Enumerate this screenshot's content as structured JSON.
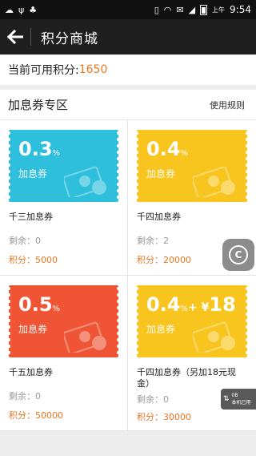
{
  "status_bar": {
    "icons_left": [
      "cloud-icon",
      "usb-icon",
      "cat-icon"
    ],
    "icons_right": [
      "vibrate-icon",
      "wifi-icon",
      "message-icon",
      "signal-icon",
      "battery-icon"
    ],
    "ampm": "上午",
    "time": "9:54"
  },
  "appbar": {
    "title": "积分商城",
    "back_icon": "arrow-left-icon"
  },
  "points": {
    "label": "当前可用积分:",
    "value": "1650"
  },
  "section": {
    "title": "加息券专区",
    "rules_link": "使用规则"
  },
  "cards": [
    {
      "rate": "0.3",
      "pct": "%",
      "plus": "",
      "extra": "",
      "type": "加息券",
      "name": "千三加息券",
      "remain": "剩余：0",
      "points": "积分：5000",
      "color": "#2ebfdc"
    },
    {
      "rate": "0.4",
      "pct": "%",
      "plus": "",
      "extra": "",
      "type": "加息券",
      "name": "千四加息券",
      "remain": "剩余：2",
      "points": "积分：20000",
      "color": "#f8c51f"
    },
    {
      "rate": "0.5",
      "pct": "%",
      "plus": "",
      "extra": "",
      "type": "加息券",
      "name": "千五加息券",
      "remain": "剩余：0",
      "points": "积分：50000",
      "color": "#ef5534"
    },
    {
      "rate": "0.4",
      "pct": "%",
      "plus": "+ ¥",
      "extra": "18",
      "type": "加息券",
      "name": "千四加息券（另加18元现金）",
      "remain": "剩余：0",
      "points": "积分：30000",
      "color": "#f8c51f"
    }
  ],
  "overlay": {
    "float_button_label": "C",
    "speed_value": "0B",
    "speed_label": "本机已用"
  }
}
